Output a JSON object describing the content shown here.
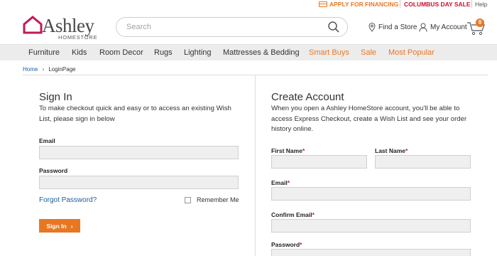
{
  "utility": {
    "financing": "APPLY FOR FINANCING",
    "sale": "COLUMBUS DAY SALE",
    "help": "Help"
  },
  "brand": {
    "name": "Ashley",
    "sub": "HOMESTORE",
    "accent": "#c2185b"
  },
  "search": {
    "placeholder": "Search"
  },
  "header": {
    "find_store": "Find a Store",
    "account": "My Account",
    "cart_count": "0"
  },
  "nav": {
    "items": [
      "Furniture",
      "Kids",
      "Room Decor",
      "Rugs",
      "Lighting",
      "Mattresses & Bedding",
      "Smart Buys",
      "Sale",
      "Most Popular"
    ],
    "promo_color": "#e87722"
  },
  "breadcrumb": {
    "home": "Home",
    "current": "LoginPage"
  },
  "signin": {
    "title": "Sign In",
    "desc": "To make checkout quick and easy or to access an existing Wish List, please sign in below",
    "email_label": "Email",
    "password_label": "Password",
    "forgot": "Forgot Password?",
    "remember": "Remember Me",
    "button": "Sign In"
  },
  "create": {
    "title": "Create Account",
    "desc": "When you open a Ashley HomeStore account, you'll be able to access Express Checkout, create a Wish List and see your order history online.",
    "first_name": "First Name",
    "last_name": "Last Name",
    "email": "Email",
    "confirm_email": "Confirm Email",
    "password": "Password",
    "required_mark": "*"
  },
  "colors": {
    "accent": "#e87722",
    "link": "#1a5e9a",
    "sale": "#c8102e"
  }
}
